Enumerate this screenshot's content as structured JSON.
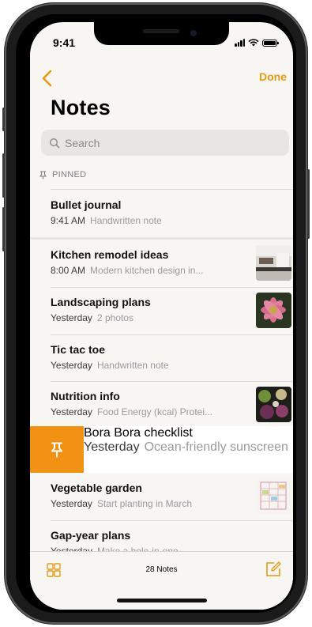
{
  "status_bar": {
    "time": "9:41"
  },
  "nav": {
    "done_label": "Done"
  },
  "title": "Notes",
  "search": {
    "placeholder": "Search"
  },
  "pinned_header": "PINNED",
  "pinned": [
    {
      "title": "Bullet journal",
      "date": "9:41 AM",
      "preview": "Handwritten note"
    }
  ],
  "notes": [
    {
      "title": "Kitchen remodel ideas",
      "date": "8:00 AM",
      "preview": "Modern kitchen design in...",
      "thumb": "kitchen"
    },
    {
      "title": "Landscaping plans",
      "date": "Yesterday",
      "preview": "2 photos",
      "thumb": "flower"
    },
    {
      "title": "Tic tac toe",
      "date": "Yesterday",
      "preview": "Handwritten note"
    },
    {
      "title": "Nutrition info",
      "date": "Yesterday",
      "preview": "Food Energy (kcal) Protei...",
      "thumb": "food"
    }
  ],
  "swiped_note": {
    "title": "Bora Bora checklist",
    "date": "Yesterday",
    "preview": "Ocean-friendly sunscreen",
    "action_icon": "pin-icon",
    "action_color": "#f19214"
  },
  "notes_after": [
    {
      "title": "Vegetable garden",
      "date": "Yesterday",
      "preview": "Start planting in March",
      "thumb": "sketch"
    },
    {
      "title": "Gap-year plans",
      "date": "Yesterday",
      "preview": "Make a hole-in-one"
    }
  ],
  "toolbar": {
    "count_label": "28 Notes"
  },
  "colors": {
    "accent": "#e79a13",
    "background": "#f7f6f3"
  }
}
